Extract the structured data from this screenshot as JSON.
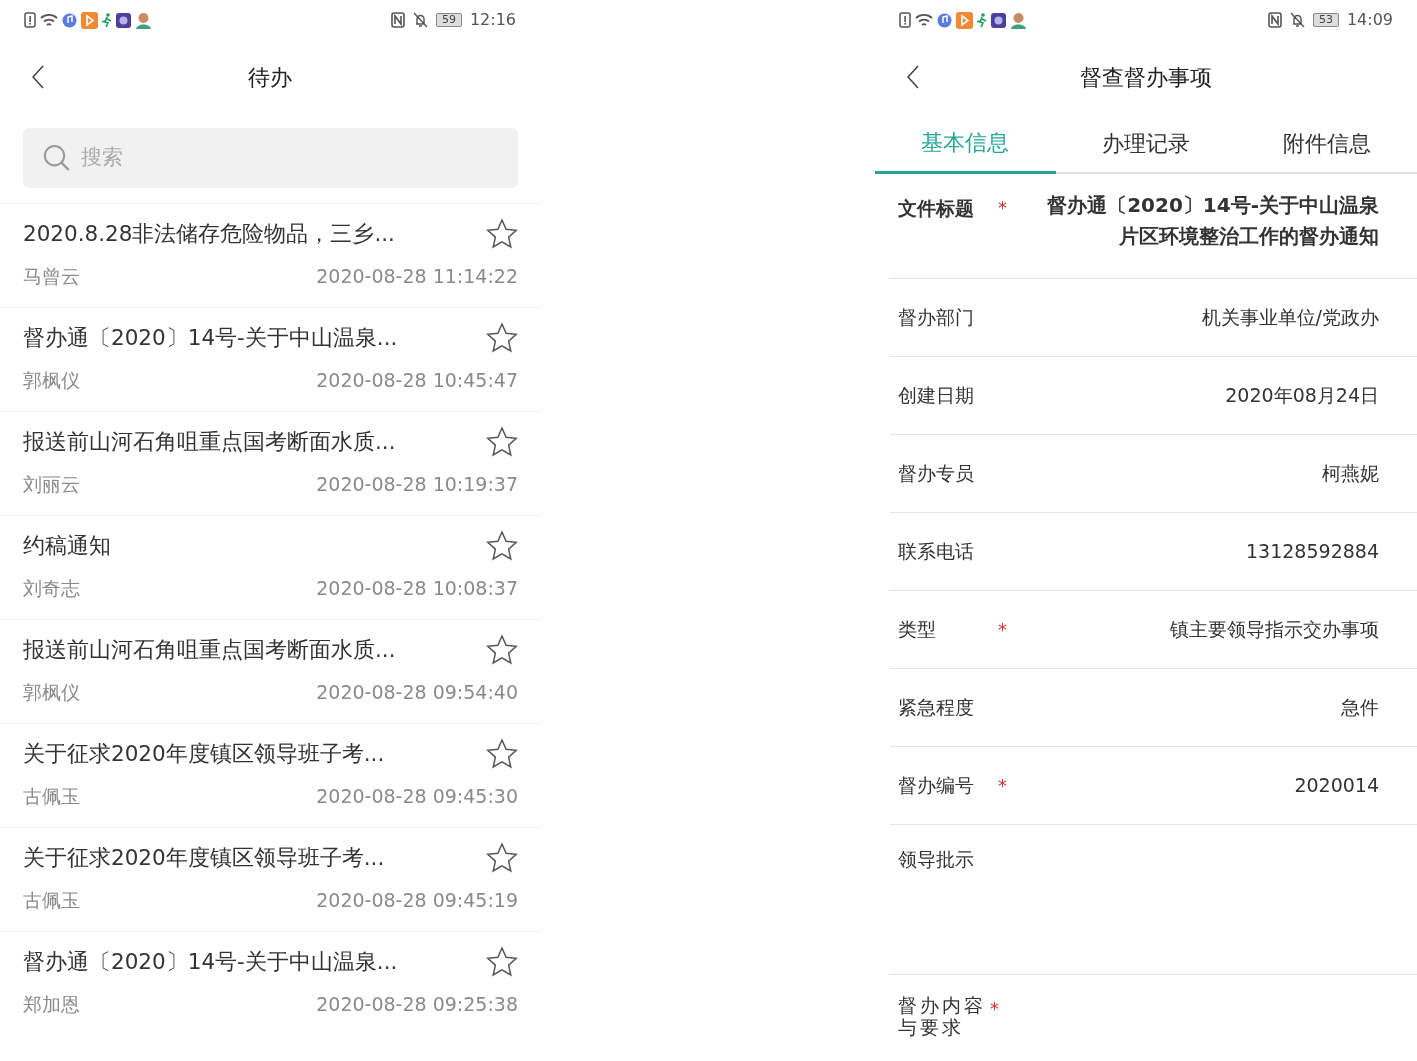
{
  "list_screen": {
    "status_bar": {
      "battery": "59",
      "time": "12:16"
    },
    "title": "待办",
    "search": {
      "placeholder": "搜索"
    },
    "items": [
      {
        "title": "2020.8.28非法储存危险物品，三乡...",
        "sender": "马曾云",
        "time": "2020-08-28 11:14:22",
        "starred": false
      },
      {
        "title": "督办通〔2020〕14号-关于中山温泉...",
        "sender": "郭枫仪",
        "time": "2020-08-28 10:45:47",
        "starred": false
      },
      {
        "title": "报送前山河石角咀重点国考断面水质...",
        "sender": "刘丽云",
        "time": "2020-08-28 10:19:37",
        "starred": false
      },
      {
        "title": "约稿通知",
        "sender": "刘奇志",
        "time": "2020-08-28 10:08:37",
        "starred": false
      },
      {
        "title": "报送前山河石角咀重点国考断面水质...",
        "sender": "郭枫仪",
        "time": "2020-08-28 09:54:40",
        "starred": false
      },
      {
        "title": "关于征求2020年度镇区领导班子考...",
        "sender": "古佩玉",
        "time": "2020-08-28 09:45:30",
        "starred": false
      },
      {
        "title": "关于征求2020年度镇区领导班子考...",
        "sender": "古佩玉",
        "time": "2020-08-28 09:45:19",
        "starred": false
      },
      {
        "title": "督办通〔2020〕14号-关于中山温泉...",
        "sender": "郑加恩",
        "time": "2020-08-28 09:25:38",
        "starred": false
      }
    ]
  },
  "detail_screen": {
    "status_bar": {
      "battery": "53",
      "time": "14:09"
    },
    "title": "督查督办事项",
    "tabs": [
      {
        "label": "基本信息",
        "selected": true
      },
      {
        "label": "办理记录",
        "selected": false
      },
      {
        "label": "附件信息",
        "selected": false
      }
    ],
    "fields": [
      {
        "kind": "heading",
        "label": "文件标题",
        "marker": "*",
        "value": "督办通〔2020〕14号-关于中山温泉片区环境整治工作的督办通知"
      },
      {
        "kind": "line",
        "label": "督办部门",
        "value": "机关事业单位/党政办"
      },
      {
        "kind": "line",
        "label": "创建日期",
        "value": "2020年08月24日"
      },
      {
        "kind": "line",
        "label": "督办专员",
        "value": "柯燕妮"
      },
      {
        "kind": "line",
        "label": "联系电话",
        "value": "13128592884"
      },
      {
        "kind": "line",
        "label": "类型",
        "marker": "*",
        "value": "镇主要领导指示交办事项"
      },
      {
        "kind": "line",
        "label": "紧急程度",
        "value": "急件"
      },
      {
        "kind": "line",
        "label": "督办编号",
        "marker": "*",
        "value": "2020014"
      },
      {
        "kind": "area",
        "label": "领导批示"
      },
      {
        "kind": "wrap",
        "label": "督办内容与要求",
        "marker": "*"
      }
    ]
  }
}
